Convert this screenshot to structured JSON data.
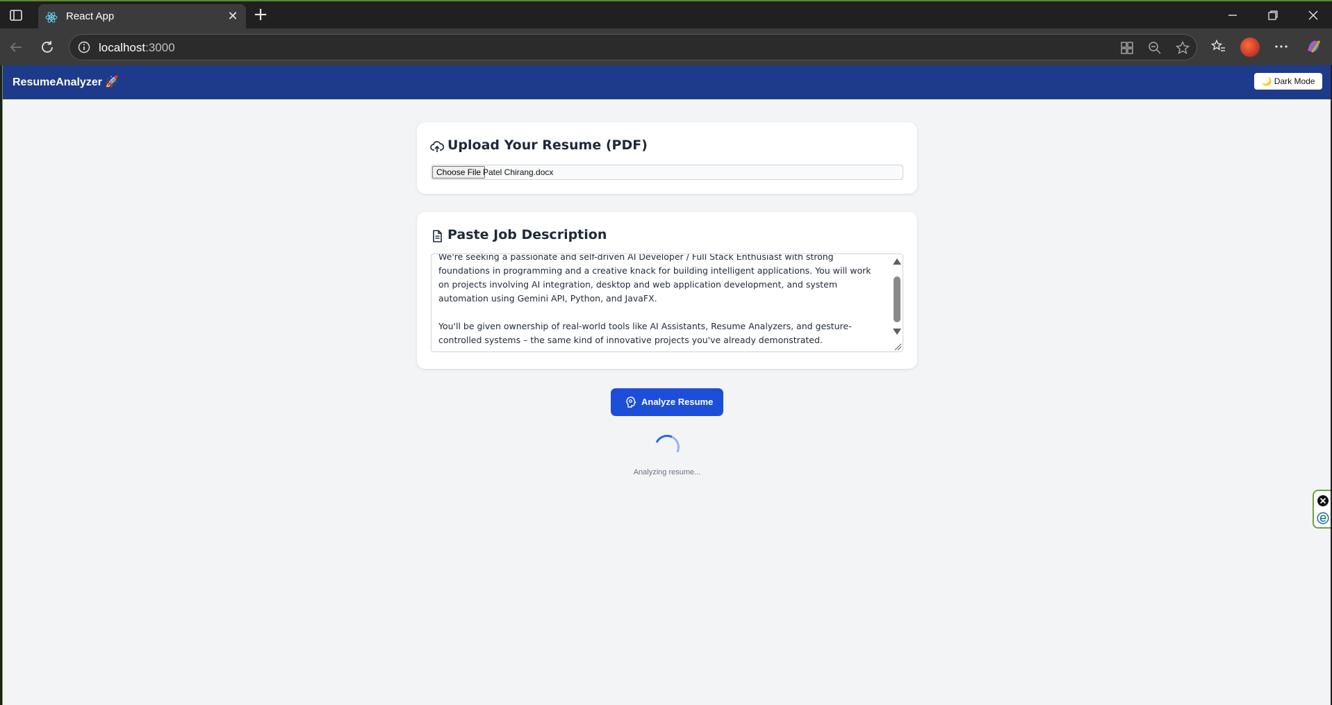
{
  "browser": {
    "tab_title": "React App",
    "url_host": "localhost",
    "url_port": ":3000",
    "new_tab_label": "+",
    "close_tab_label": "✕"
  },
  "header": {
    "brand": "ResumeAnalyzer 🚀",
    "dark_mode_label": "🌙 Dark Mode"
  },
  "upload": {
    "title": "Upload Your Resume (PDF)",
    "choose_label": "Choose File",
    "file_name": "Patel Chirang.docx"
  },
  "job": {
    "title": "Paste Job Description",
    "description": "We're seeking a passionate and self-driven AI Developer / Full Stack Enthusiast with strong foundations in programming and a creative knack for building intelligent applications. You will work on projects involving AI integration, desktop and web application development, and system automation using Gemini API, Python, and JavaFX.\n\nYou'll be given ownership of real-world tools like AI Assistants, Resume Analyzers, and gesture-controlled systems – the same kind of innovative projects you've already demonstrated."
  },
  "analyze": {
    "button_label": "Analyze Resume",
    "status": "Analyzing resume..."
  },
  "colors": {
    "header_bg": "#1e3a8a",
    "button_bg": "#1d4ed8",
    "page_bg": "#f3f4f6"
  },
  "icons": {
    "upload": "cloud-upload-icon",
    "document": "document-icon",
    "analyze": "brain-icon"
  }
}
